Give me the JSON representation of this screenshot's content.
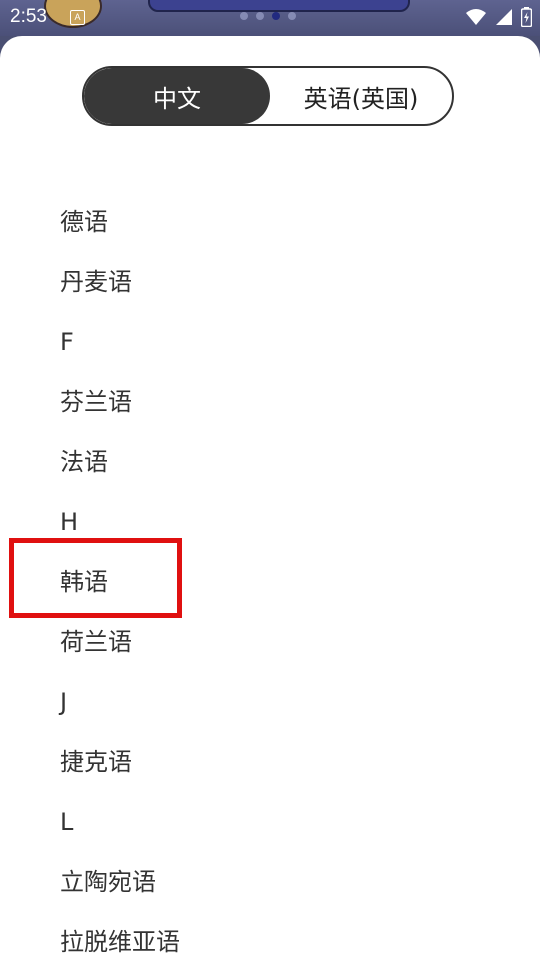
{
  "status": {
    "time": "2:53",
    "notification_icon": "A"
  },
  "tabs": [
    {
      "label": "中文",
      "selected": true
    },
    {
      "label": "英语(英国)",
      "selected": false
    }
  ],
  "languages": [
    {
      "label": "德语"
    },
    {
      "label": "丹麦语"
    },
    {
      "label": "F"
    },
    {
      "label": "芬兰语"
    },
    {
      "label": "法语"
    },
    {
      "label": "H"
    },
    {
      "label": "韩语"
    },
    {
      "label": "荷兰语"
    },
    {
      "label": "J"
    },
    {
      "label": "捷克语"
    },
    {
      "label": "L"
    },
    {
      "label": "立陶宛语"
    },
    {
      "label": "拉脱维亚语"
    }
  ],
  "highlight": {
    "target": "韩语",
    "color": "#e01010"
  }
}
